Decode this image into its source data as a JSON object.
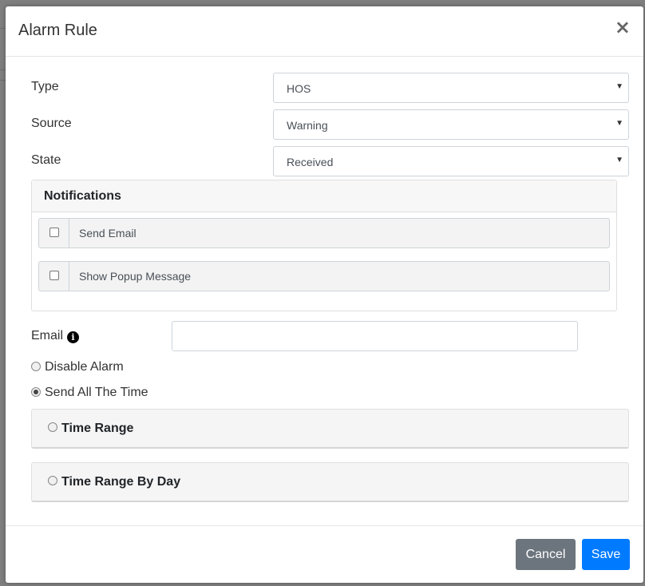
{
  "modal": {
    "title": "Alarm Rule",
    "close_symbol": "×"
  },
  "form": {
    "type_label": "Type",
    "type_value": "HOS",
    "source_label": "Source",
    "source_value": "Warning",
    "state_label": "State",
    "state_value": "Received",
    "caret": "▼"
  },
  "notifications": {
    "header": "Notifications",
    "items": [
      {
        "label": "Send Email",
        "checked": false
      },
      {
        "label": "Show Popup Message",
        "checked": false
      }
    ]
  },
  "email": {
    "label": "Email",
    "info_symbol": "i",
    "value": "",
    "placeholder": ""
  },
  "schedule": {
    "options": [
      {
        "label": "Disable Alarm",
        "selected": false
      },
      {
        "label": "Send All The Time",
        "selected": true
      }
    ],
    "panels": [
      {
        "label": "Time Range",
        "selected": false
      },
      {
        "label": "Time Range By Day",
        "selected": false
      }
    ]
  },
  "footer": {
    "cancel_label": "Cancel",
    "save_label": "Save"
  },
  "colors": {
    "primary": "#007bff",
    "secondary": "#6c757d",
    "backdrop": "#7f7f7f"
  }
}
